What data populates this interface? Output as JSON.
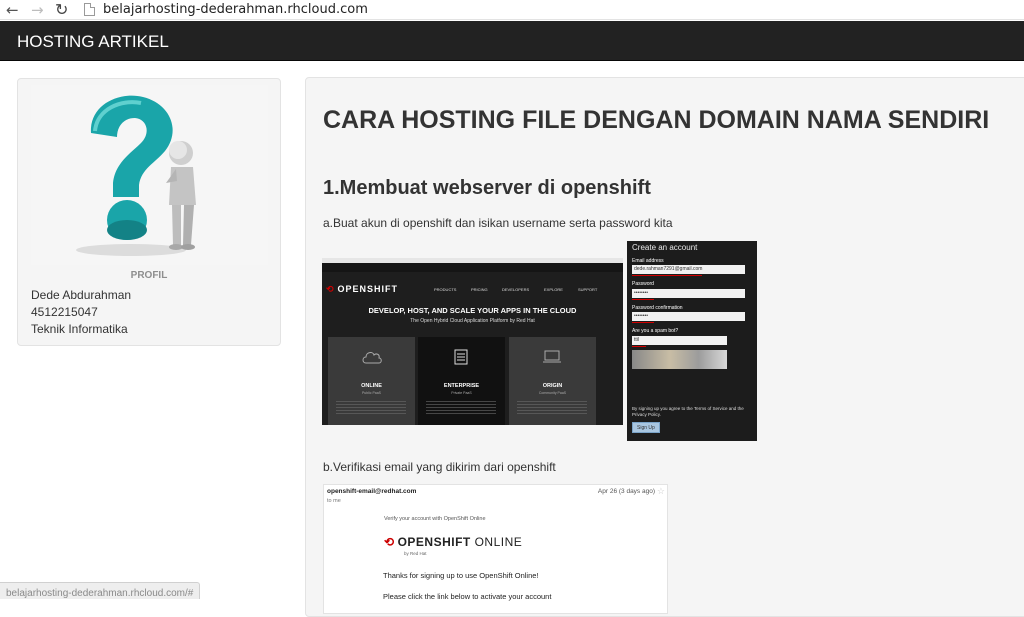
{
  "browser": {
    "back_glyph": "←",
    "forward_glyph": "→",
    "reload_glyph": "↻",
    "url": "belajarhosting-dederahman.rhcloud.com",
    "status_url": "belajarhosting-dederahman.rhcloud.com/#"
  },
  "header": {
    "brand": "HOSTING ARTIKEL",
    "background": "#222222"
  },
  "profile": {
    "caption": "PROFIL",
    "name": "Dede Abdurahman",
    "id_number": "4512215047",
    "major": "Teknik Informatika"
  },
  "article": {
    "title": "CARA HOSTING FILE DENGAN DOMAIN NAMA SENDIRI",
    "section1_heading": "1.Membuat webserver di openshift",
    "step_a": "a.Buat akun di openshift dan isikan username serta password kita",
    "step_b": "b.Verifikasi email yang dikirim dari openshift"
  },
  "openshift_home": {
    "logo": "OPENSHIFT",
    "menu": [
      "PRODUCTS",
      "PRICING",
      "DEVELOPERS",
      "EXPLORE",
      "SUPPORT"
    ],
    "hero": "DEVELOP, HOST, AND SCALE YOUR APPS IN THE CLOUD",
    "subhero": "The Open Hybrid Cloud Application Platform by Red Hat",
    "columns": [
      {
        "title": "ONLINE",
        "sub": "Public PaaS"
      },
      {
        "title": "ENTERPRISE",
        "sub": "Private PaaS"
      },
      {
        "title": "ORIGIN",
        "sub": "Community PaaS"
      }
    ]
  },
  "signup_form": {
    "title": "Create an account",
    "email_label": "Email address",
    "email_value": "dede.rahman7291@gmail.com",
    "password_label": "Password",
    "password_value": "••••••••",
    "confirm_label": "Password confirmation",
    "confirm_value": "••••••••",
    "spam_label": "Are you a spam bot?",
    "spam_value": "ttil",
    "terms_text": "By signing up you agree to the Terms of Service and the Privacy Policy.",
    "button": "Sign Up",
    "accent": "#d10000"
  },
  "email": {
    "from": "openshift-email@redhat.com",
    "date": "Apr 26 (3 days ago)",
    "to": "to me",
    "verify_line": "Verify your account with OpenShift Online",
    "logo_main": "OPENSHIFT",
    "logo_online": "ONLINE",
    "logo_sub": "by Red Hat",
    "thanks": "Thanks for signing up to use OpenShift Online!",
    "please": "Please click the link below to activate your account"
  }
}
